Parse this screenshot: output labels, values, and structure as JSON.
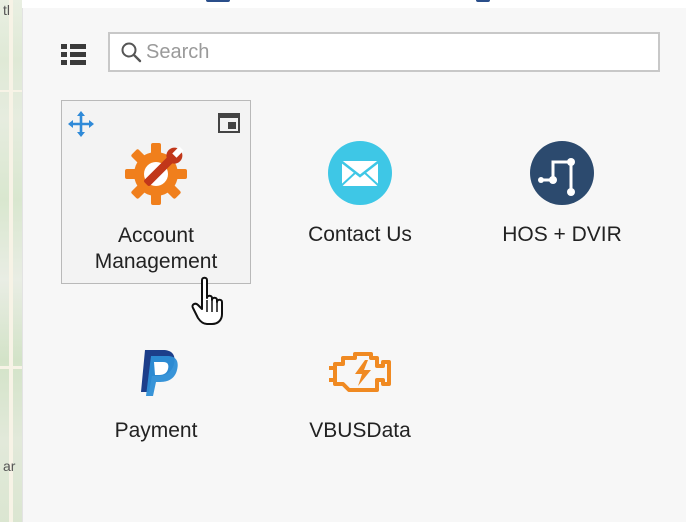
{
  "search": {
    "placeholder": "Search",
    "value": ""
  },
  "apps": [
    {
      "label": "Account\nManagement",
      "icon": "gear-wrench-icon",
      "active": true
    },
    {
      "label": "Contact Us",
      "icon": "mail-icon"
    },
    {
      "label": "HOS + DVIR",
      "icon": "route-icon"
    },
    {
      "label": "Payment",
      "icon": "paypal-icon"
    },
    {
      "label": "VBUSData",
      "icon": "engine-warning-icon"
    }
  ],
  "colors": {
    "accent_blue": "#2f8ad8",
    "gear_orange": "#f07f1c",
    "mail_cyan": "#3ec7e6",
    "hos_navy": "#2c4a6e",
    "paypal_dark": "#1c3e8a",
    "paypal_light": "#2d8ed6",
    "engine_orange": "#f08a22"
  }
}
